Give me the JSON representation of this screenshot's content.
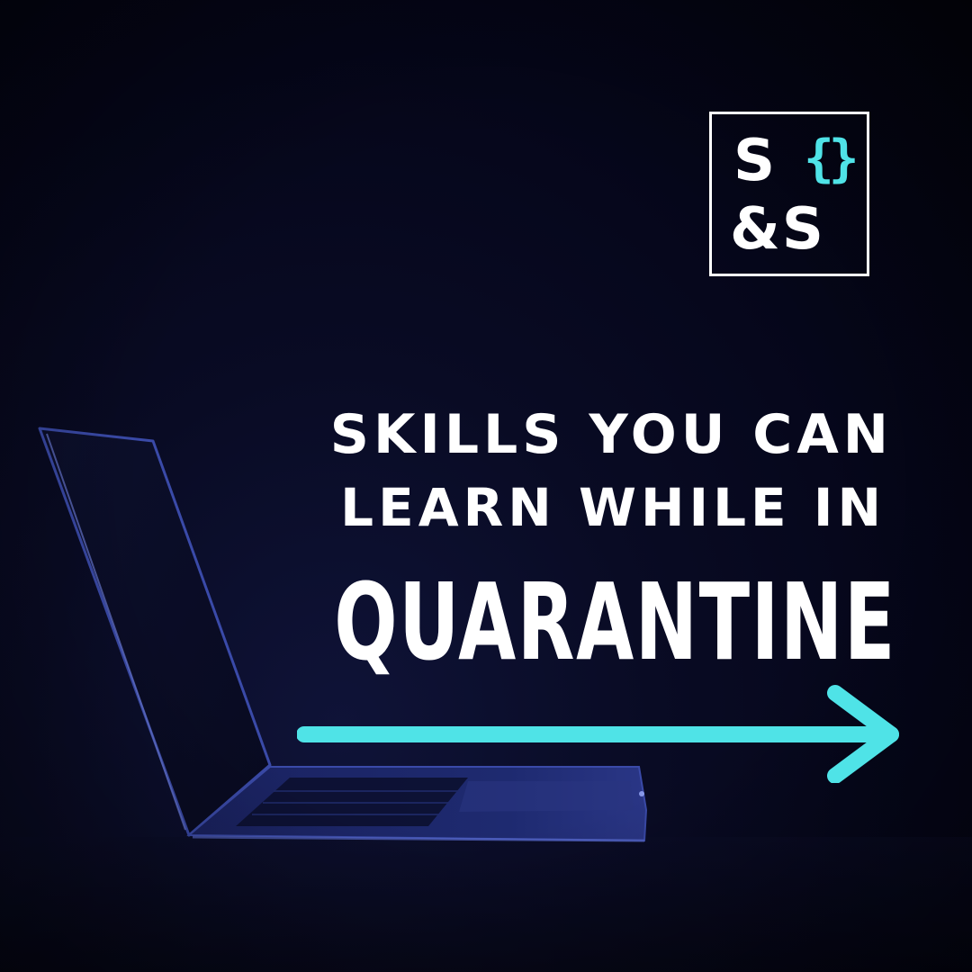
{
  "logo": {
    "letters_top": "S",
    "braces": "{}",
    "letters_bottom": "&S",
    "accent_color": "#4fe3e7"
  },
  "headline": {
    "line1": "SKILLS YOU CAN",
    "line2": "LEARN WHILE  IN",
    "line3": "QUARANTINE"
  },
  "arrow": {
    "icon": "arrow-right-icon",
    "color": "#4fe3e7"
  },
  "background": {
    "image": "laptop-in-dark",
    "colors": [
      "#05061a",
      "#0f1338"
    ]
  }
}
